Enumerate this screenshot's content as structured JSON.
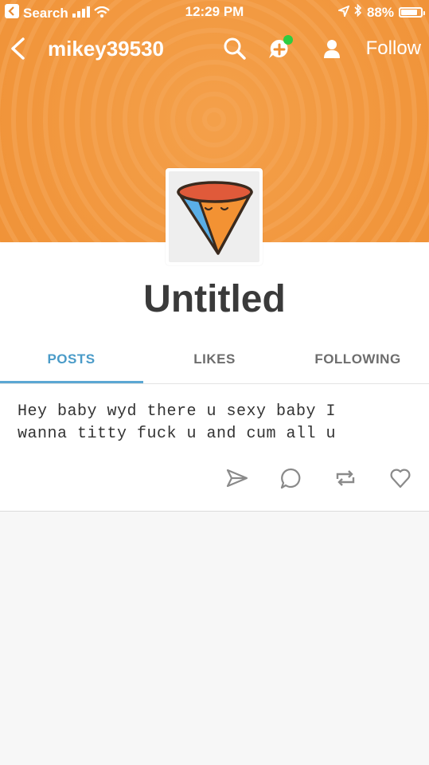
{
  "status_bar": {
    "back_app": "Search",
    "time": "12:29 PM",
    "battery": "88%"
  },
  "nav": {
    "username": "mikey39530",
    "follow_label": "Follow"
  },
  "profile": {
    "title": "Untitled"
  },
  "tabs": [
    {
      "label": "POSTS",
      "active": true
    },
    {
      "label": "LIKES",
      "active": false
    },
    {
      "label": "FOLLOWING",
      "active": false
    }
  ],
  "post": {
    "text_line1": "Hey baby wyd there u sexy baby I",
    "text_line2": "wanna titty fuck u and cum all u"
  },
  "icons": {
    "back": "chevron-left-icon",
    "search": "search-icon",
    "compose": "new-message-icon",
    "profile": "person-icon",
    "share": "send-icon",
    "reply": "comment-icon",
    "reblog": "reblog-icon",
    "like": "heart-icon"
  },
  "colors": {
    "header_orange": "#ef8f33",
    "accent_blue": "#4a9bc8",
    "notification_green": "#2ecc40"
  }
}
